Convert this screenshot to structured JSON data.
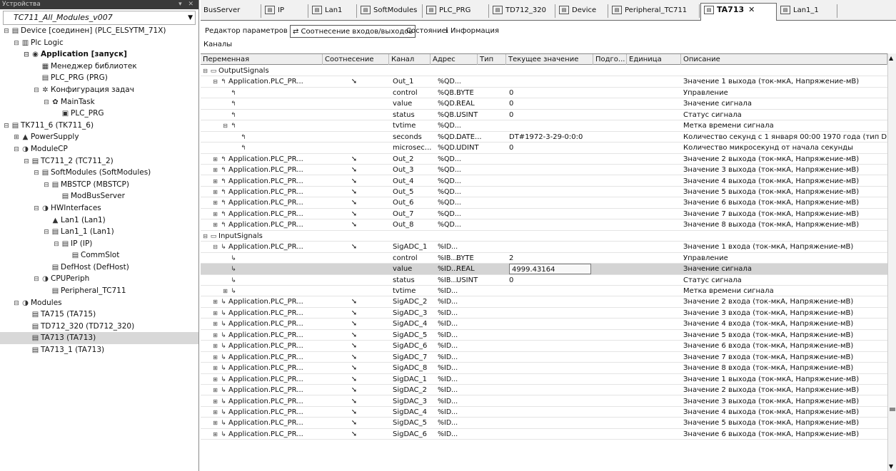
{
  "left_panel": {
    "title": "Устройства",
    "project": "TC711_All_Modules_v007",
    "tree": [
      {
        "indent": 0,
        "exp": "⊟",
        "ico": "▤",
        "label": "Device [соединен] (PLC_ELSYTM_71X)"
      },
      {
        "indent": 1,
        "exp": "⊟",
        "ico": "▥",
        "label": "Plc Logic"
      },
      {
        "indent": 2,
        "exp": "⊟",
        "ico": "◉",
        "label": "Application [запуск]",
        "bold": true
      },
      {
        "indent": 3,
        "exp": "",
        "ico": "▦",
        "label": "Менеджер библиотек"
      },
      {
        "indent": 3,
        "exp": "",
        "ico": "▤",
        "label": "PLC_PRG (PRG)"
      },
      {
        "indent": 3,
        "exp": "⊟",
        "ico": "✲",
        "label": "Конфигурация задач"
      },
      {
        "indent": 4,
        "exp": "⊟",
        "ico": "✿",
        "label": "MainTask"
      },
      {
        "indent": 5,
        "exp": "",
        "ico": "▣",
        "label": "PLC_PRG"
      },
      {
        "indent": 0,
        "exp": "⊟",
        "ico": "▤",
        "label": "TK711_6 (TK711_6)"
      },
      {
        "indent": 1,
        "exp": "⊞",
        "ico": "▲",
        "label": "PowerSupply"
      },
      {
        "indent": 1,
        "exp": "⊟",
        "ico": "◑",
        "label": "ModuleCP"
      },
      {
        "indent": 2,
        "exp": "⊟",
        "ico": "▤",
        "label": "TC711_2 (TC711_2)"
      },
      {
        "indent": 3,
        "exp": "⊟",
        "ico": "▤",
        "label": "SoftModules (SoftModules)"
      },
      {
        "indent": 4,
        "exp": "⊟",
        "ico": "▤",
        "label": "MBSTCP (MBSTCP)"
      },
      {
        "indent": 5,
        "exp": "",
        "ico": "▤",
        "label": "ModBusServer"
      },
      {
        "indent": 3,
        "exp": "⊟",
        "ico": "◑",
        "label": "HWInterfaces"
      },
      {
        "indent": 4,
        "exp": "",
        "ico": "▲",
        "label": "Lan1 (Lan1)"
      },
      {
        "indent": 4,
        "exp": "⊟",
        "ico": "▤",
        "label": "Lan1_1 (Lan1)"
      },
      {
        "indent": 5,
        "exp": "⊟",
        "ico": "▤",
        "label": "IP (IP)"
      },
      {
        "indent": 6,
        "exp": "",
        "ico": "▤",
        "label": "CommSlot"
      },
      {
        "indent": 4,
        "exp": "",
        "ico": "▤",
        "label": "DefHost (DefHost)"
      },
      {
        "indent": 3,
        "exp": "⊟",
        "ico": "◑",
        "label": "CPUPeriph"
      },
      {
        "indent": 4,
        "exp": "",
        "ico": "▤",
        "label": "Peripheral_TC711"
      },
      {
        "indent": 1,
        "exp": "⊟",
        "ico": "◑",
        "label": "Modules"
      },
      {
        "indent": 2,
        "exp": "",
        "ico": "▤",
        "label": "TA715 (TA715)"
      },
      {
        "indent": 2,
        "exp": "",
        "ico": "▤",
        "label": "TD712_320 (TD712_320)"
      },
      {
        "indent": 2,
        "exp": "",
        "ico": "▤",
        "label": "TA713 (TA713)",
        "selected": true
      },
      {
        "indent": 2,
        "exp": "",
        "ico": "▤",
        "label": "TA713_1 (TA713)"
      }
    ]
  },
  "tabs": [
    {
      "label": "BusServer",
      "icon": false
    },
    {
      "label": "IP",
      "icon": true
    },
    {
      "label": "Lan1",
      "icon": true
    },
    {
      "label": "SoftModules",
      "icon": true
    },
    {
      "label": "PLC_PRG",
      "icon": true
    },
    {
      "label": "TD712_320",
      "icon": true
    },
    {
      "label": "Device",
      "icon": true
    },
    {
      "label": "Peripheral_TC711",
      "icon": true
    },
    {
      "label": "TA713",
      "icon": true,
      "active": true
    },
    {
      "label": "Lan1_1",
      "icon": true
    }
  ],
  "close_glyph": "✕",
  "subtabs": [
    {
      "label": "Редактор параметров"
    },
    {
      "label": "⇄ Соотнесение входов/выходов",
      "active": true
    },
    {
      "label": "Состояние"
    },
    {
      "label": "ℹ Информация"
    }
  ],
  "channels_label": "Каналы",
  "columns": [
    "Переменная",
    "Соотнесение",
    "Канал",
    "Адрес",
    "Тип",
    "Текущее значение",
    "Подго...",
    "Единица",
    "Описание"
  ],
  "rows": [
    {
      "lvl": 0,
      "exp": "⊟",
      "ico": "▭",
      "var": "OutputSignals",
      "map": "",
      "chan": "",
      "addr": "",
      "type": "",
      "cur": "",
      "desc": ""
    },
    {
      "lvl": 1,
      "exp": "⊟",
      "ico": "↰",
      "var": "Application.PLC_PR...",
      "map": "➘",
      "chan": "Out_1",
      "addr": "%QD...",
      "type": "",
      "cur": "",
      "desc": "Значение 1 выхода (ток-мкА, Напряжение-мВ)"
    },
    {
      "lvl": 2,
      "exp": "",
      "ico": "↰",
      "var": "",
      "map": "",
      "chan": "control",
      "addr": "%QB...",
      "type": "BYTE",
      "cur": "0",
      "desc": "Управление"
    },
    {
      "lvl": 2,
      "exp": "",
      "ico": "↰",
      "var": "",
      "map": "",
      "chan": "value",
      "addr": "%QD...",
      "type": "REAL",
      "cur": "0",
      "desc": "Значение сигнала"
    },
    {
      "lvl": 2,
      "exp": "",
      "ico": "↰",
      "var": "",
      "map": "",
      "chan": "status",
      "addr": "%QB...",
      "type": "USINT",
      "cur": "0",
      "desc": "Статус сигнала"
    },
    {
      "lvl": 2,
      "exp": "⊟",
      "ico": "↰",
      "var": "",
      "map": "",
      "chan": "tvtime",
      "addr": "%QD...",
      "type": "",
      "cur": "",
      "desc": "Метка времени сигнала"
    },
    {
      "lvl": 3,
      "exp": "",
      "ico": "↰",
      "var": "",
      "map": "",
      "chan": "seconds",
      "addr": "%QD...",
      "type": "DATE...",
      "cur": "DT#1972-3-29-0:0:0",
      "desc": "Количество секунд с 1 января 00:00 1970 года (тип D"
    },
    {
      "lvl": 3,
      "exp": "",
      "ico": "↰",
      "var": "",
      "map": "",
      "chan": "microsec...",
      "addr": "%QD...",
      "type": "UDINT",
      "cur": "0",
      "desc": "Количество микросекунд от начала секунды"
    },
    {
      "lvl": 1,
      "exp": "⊞",
      "ico": "↰",
      "var": "Application.PLC_PR...",
      "map": "➘",
      "chan": "Out_2",
      "addr": "%QD...",
      "type": "",
      "cur": "",
      "desc": "Значение 2 выхода (ток-мкА, Напряжение-мВ)"
    },
    {
      "lvl": 1,
      "exp": "⊞",
      "ico": "↰",
      "var": "Application.PLC_PR...",
      "map": "➘",
      "chan": "Out_3",
      "addr": "%QD...",
      "type": "",
      "cur": "",
      "desc": "Значение 3 выхода (ток-мкА, Напряжение-мВ)"
    },
    {
      "lvl": 1,
      "exp": "⊞",
      "ico": "↰",
      "var": "Application.PLC_PR...",
      "map": "➘",
      "chan": "Out_4",
      "addr": "%QD...",
      "type": "",
      "cur": "",
      "desc": "Значение 4 выхода (ток-мкА, Напряжение-мВ)"
    },
    {
      "lvl": 1,
      "exp": "⊞",
      "ico": "↰",
      "var": "Application.PLC_PR...",
      "map": "➘",
      "chan": "Out_5",
      "addr": "%QD...",
      "type": "",
      "cur": "",
      "desc": "Значение 5 выхода (ток-мкА, Напряжение-мВ)"
    },
    {
      "lvl": 1,
      "exp": "⊞",
      "ico": "↰",
      "var": "Application.PLC_PR...",
      "map": "➘",
      "chan": "Out_6",
      "addr": "%QD...",
      "type": "",
      "cur": "",
      "desc": "Значение 6 выхода (ток-мкА, Напряжение-мВ)"
    },
    {
      "lvl": 1,
      "exp": "⊞",
      "ico": "↰",
      "var": "Application.PLC_PR...",
      "map": "➘",
      "chan": "Out_7",
      "addr": "%QD...",
      "type": "",
      "cur": "",
      "desc": "Значение 7 выхода (ток-мкА, Напряжение-мВ)"
    },
    {
      "lvl": 1,
      "exp": "⊞",
      "ico": "↰",
      "var": "Application.PLC_PR...",
      "map": "➘",
      "chan": "Out_8",
      "addr": "%QD...",
      "type": "",
      "cur": "",
      "desc": "Значение 8 выхода (ток-мкА, Напряжение-мВ)"
    },
    {
      "lvl": 0,
      "exp": "⊟",
      "ico": "▭",
      "var": "InputSignals",
      "map": "",
      "chan": "",
      "addr": "",
      "type": "",
      "cur": "",
      "desc": ""
    },
    {
      "lvl": 1,
      "exp": "⊟",
      "ico": "↳",
      "var": "Application.PLC_PR...",
      "map": "➘",
      "chan": "SigADC_1",
      "addr": "%ID...",
      "type": "",
      "cur": "",
      "desc": "Значение 1 входа (ток-мкА, Напряжение-мВ)"
    },
    {
      "lvl": 2,
      "exp": "",
      "ico": "↳",
      "var": "",
      "map": "",
      "chan": "control",
      "addr": "%IB...",
      "type": "BYTE",
      "cur": "2",
      "desc": "Управление"
    },
    {
      "lvl": 2,
      "exp": "",
      "ico": "↳",
      "var": "",
      "map": "",
      "chan": "value",
      "addr": "%ID...",
      "type": "REAL",
      "cur": "4999.43164",
      "desc": "Значение сигнала",
      "highlight": true
    },
    {
      "lvl": 2,
      "exp": "",
      "ico": "↳",
      "var": "",
      "map": "",
      "chan": "status",
      "addr": "%IB...",
      "type": "USINT",
      "cur": "0",
      "desc": "Статус сигнала"
    },
    {
      "lvl": 2,
      "exp": "⊞",
      "ico": "↳",
      "var": "",
      "map": "",
      "chan": "tvtime",
      "addr": "%ID...",
      "type": "",
      "cur": "",
      "desc": "Метка времени сигнала"
    },
    {
      "lvl": 1,
      "exp": "⊞",
      "ico": "↳",
      "var": "Application.PLC_PR...",
      "map": "➘",
      "chan": "SigADC_2",
      "addr": "%ID...",
      "type": "",
      "cur": "",
      "desc": "Значение 2 входа (ток-мкА, Напряжение-мВ)"
    },
    {
      "lvl": 1,
      "exp": "⊞",
      "ico": "↳",
      "var": "Application.PLC_PR...",
      "map": "➘",
      "chan": "SigADC_3",
      "addr": "%ID...",
      "type": "",
      "cur": "",
      "desc": "Значение 3 входа (ток-мкА, Напряжение-мВ)"
    },
    {
      "lvl": 1,
      "exp": "⊞",
      "ico": "↳",
      "var": "Application.PLC_PR...",
      "map": "➘",
      "chan": "SigADC_4",
      "addr": "%ID...",
      "type": "",
      "cur": "",
      "desc": "Значение 4 входа (ток-мкА, Напряжение-мВ)"
    },
    {
      "lvl": 1,
      "exp": "⊞",
      "ico": "↳",
      "var": "Application.PLC_PR...",
      "map": "➘",
      "chan": "SigADC_5",
      "addr": "%ID...",
      "type": "",
      "cur": "",
      "desc": "Значение 5 входа (ток-мкА, Напряжение-мВ)"
    },
    {
      "lvl": 1,
      "exp": "⊞",
      "ico": "↳",
      "var": "Application.PLC_PR...",
      "map": "➘",
      "chan": "SigADC_6",
      "addr": "%ID...",
      "type": "",
      "cur": "",
      "desc": "Значение 6 входа (ток-мкА, Напряжение-мВ)"
    },
    {
      "lvl": 1,
      "exp": "⊞",
      "ico": "↳",
      "var": "Application.PLC_PR...",
      "map": "➘",
      "chan": "SigADC_7",
      "addr": "%ID...",
      "type": "",
      "cur": "",
      "desc": "Значение 7 входа (ток-мкА, Напряжение-мВ)"
    },
    {
      "lvl": 1,
      "exp": "⊞",
      "ico": "↳",
      "var": "Application.PLC_PR...",
      "map": "➘",
      "chan": "SigADC_8",
      "addr": "%ID...",
      "type": "",
      "cur": "",
      "desc": "Значение 8 входа (ток-мкА, Напряжение-мВ)"
    },
    {
      "lvl": 1,
      "exp": "⊞",
      "ico": "↳",
      "var": "Application.PLC_PR...",
      "map": "➘",
      "chan": "SigDAC_1",
      "addr": "%ID...",
      "type": "",
      "cur": "",
      "desc": "Значение 1 выхода (ток-мкА, Напряжение-мВ)"
    },
    {
      "lvl": 1,
      "exp": "⊞",
      "ico": "↳",
      "var": "Application.PLC_PR...",
      "map": "➘",
      "chan": "SigDAC_2",
      "addr": "%ID...",
      "type": "",
      "cur": "",
      "desc": "Значение 2 выхода (ток-мкА, Напряжение-мВ)"
    },
    {
      "lvl": 1,
      "exp": "⊞",
      "ico": "↳",
      "var": "Application.PLC_PR...",
      "map": "➘",
      "chan": "SigDAC_3",
      "addr": "%ID...",
      "type": "",
      "cur": "",
      "desc": "Значение 3 выхода (ток-мкА, Напряжение-мВ)"
    },
    {
      "lvl": 1,
      "exp": "⊞",
      "ico": "↳",
      "var": "Application.PLC_PR...",
      "map": "➘",
      "chan": "SigDAC_4",
      "addr": "%ID...",
      "type": "",
      "cur": "",
      "desc": "Значение 4 выхода (ток-мкА, Напряжение-мВ)"
    },
    {
      "lvl": 1,
      "exp": "⊞",
      "ico": "↳",
      "var": "Application.PLC_PR...",
      "map": "➘",
      "chan": "SigDAC_5",
      "addr": "%ID...",
      "type": "",
      "cur": "",
      "desc": "Значение 5 выхода (ток-мкА, Напряжение-мВ)"
    },
    {
      "lvl": 1,
      "exp": "⊞",
      "ico": "↳",
      "var": "Application.PLC_PR...",
      "map": "➘",
      "chan": "SigDAC_6",
      "addr": "%ID...",
      "type": "",
      "cur": "",
      "desc": "Значение 6 выхода (ток-мкА, Напряжение-мВ)"
    }
  ]
}
